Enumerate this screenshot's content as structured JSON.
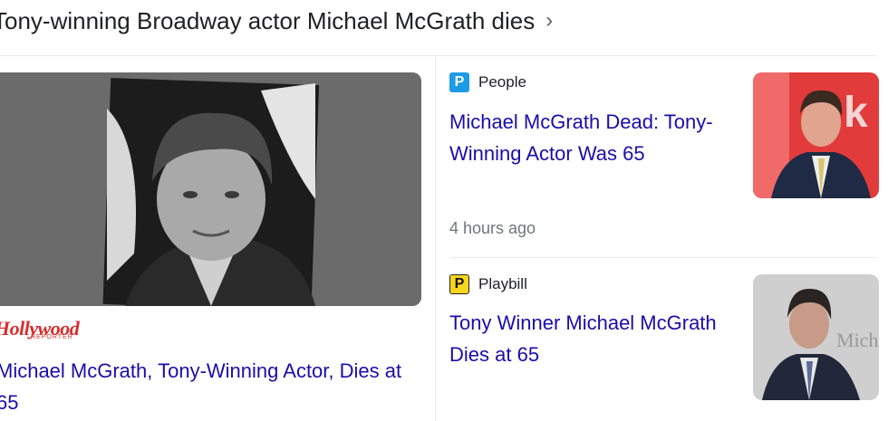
{
  "header": {
    "title": "Tony-winning Broadway actor Michael McGrath dies",
    "chevron": "›"
  },
  "main_story": {
    "image_icon": "portrait-photo",
    "source_logo_top": "Hollywood",
    "source_logo_bottom": "REPORTER",
    "title": "Michael McGrath, Tony-Winning Actor, Dies at 65"
  },
  "stories": [
    {
      "source": "People",
      "source_icon_letter": "P",
      "title": "Michael McGrath Dead: Tony-Winning Actor Was 65",
      "time": "4 hours ago"
    },
    {
      "source": "Playbill",
      "source_icon_letter": "P",
      "title": "Tony Winner Michael McGrath Dies at 65"
    }
  ],
  "colors": {
    "link": "#1a0dab",
    "people_brand": "#1e9be5",
    "playbill_brand": "#f7d51d",
    "thr_red": "#d92c2c"
  }
}
